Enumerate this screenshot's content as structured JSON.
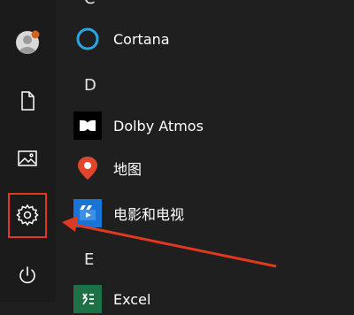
{
  "start_menu": {
    "sections": [
      {
        "letter": "C",
        "apps": [
          {
            "name": "Cortana",
            "icon": "cortana-ring-icon"
          }
        ]
      },
      {
        "letter": "D",
        "apps": [
          {
            "name": "Dolby Atmos",
            "icon": "dolby-icon"
          },
          {
            "name": "地图",
            "icon": "map-pin-icon"
          },
          {
            "name": "电影和电视",
            "icon": "movies-tv-icon"
          }
        ]
      },
      {
        "letter": "E",
        "apps": [
          {
            "name": "Excel",
            "icon": "excel-icon"
          }
        ]
      }
    ]
  },
  "rail": {
    "items": [
      {
        "name": "user-account",
        "icon": "avatar-icon"
      },
      {
        "name": "documents",
        "icon": "document-icon"
      },
      {
        "name": "pictures",
        "icon": "picture-icon"
      },
      {
        "name": "settings",
        "icon": "gear-icon",
        "highlighted": true
      },
      {
        "name": "power",
        "icon": "power-icon"
      }
    ]
  },
  "colors": {
    "background": "#1f1f1f",
    "highlight_border": "#e0391f",
    "arrow": "#e0391f",
    "cortana": "#2aa6e0",
    "maps": "#e0462a",
    "movies": "#1a73d9",
    "excel": "#1e7145"
  }
}
